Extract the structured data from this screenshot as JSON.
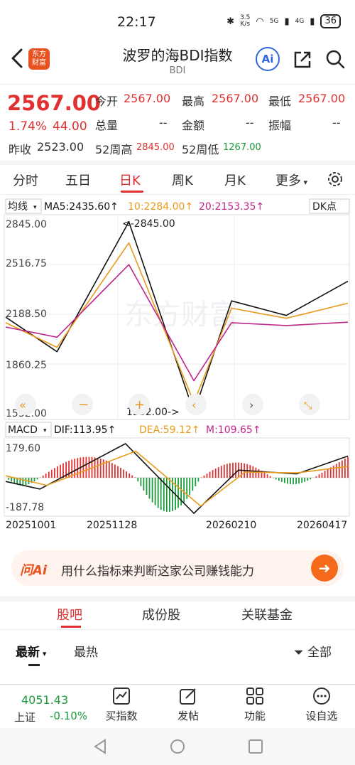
{
  "status": {
    "time": "22:17",
    "network_speed_top": "3.5",
    "network_speed_unit": "K/s",
    "signal_1": "5G",
    "signal_2": "4G",
    "battery": "36"
  },
  "header": {
    "logo_line1": "东方",
    "logo_line2": "财富",
    "title": "波罗的海BDI指数",
    "subtitle": "BDI",
    "ai_label": "Ai"
  },
  "quote": {
    "price": "2567.00",
    "change_pct": "1.74%",
    "change_abs": "44.00",
    "open_label": "今开",
    "open": "2567.00",
    "high_label": "最高",
    "high": "2567.00",
    "low_label": "最低",
    "low": "2567.00",
    "volume_label": "总量",
    "volume": "--",
    "amount_label": "金额",
    "amount": "--",
    "amplitude_label": "振幅",
    "amplitude": "--",
    "prev_close_label": "昨收",
    "prev_close": "2523.00",
    "week52_high_label": "52周高",
    "week52_high": "2845.00",
    "week52_low_label": "52周低",
    "week52_low": "1267.00"
  },
  "tabs": [
    {
      "label": "分时"
    },
    {
      "label": "五日"
    },
    {
      "label": "日K"
    },
    {
      "label": "周K"
    },
    {
      "label": "月K"
    },
    {
      "label": "更多"
    }
  ],
  "chart": {
    "ma_selector": "均线",
    "ma5_label": "MA5:2435.60↑",
    "ma10_label": "10:2284.00↑",
    "ma20_label": "20:2153.35↑",
    "dk_label": "DK点",
    "y_ticks": [
      "2845.00",
      "2516.75",
      "2188.50",
      "1860.25",
      "1532.00"
    ],
    "max_annotation": "<-2845.00",
    "min_annotation": "1532.00->",
    "watermark": "东方财富",
    "macd_selector": "MACD",
    "dif_label": "DIF:113.95↑",
    "dea_label": "DEA:59.12↑",
    "m_label": "M:109.65↑",
    "macd_top": "179.60",
    "macd_bottom": "-187.78",
    "dates": [
      "20251001",
      "20251128",
      "20260210",
      "20260417"
    ],
    "colors": {
      "ma5": "#111111",
      "ma10": "#e89a1a",
      "ma20": "#c0268a",
      "up": "#e03030",
      "down": "#1a9a3a"
    }
  },
  "chart_data": {
    "type": "line",
    "x": [
      "20251001",
      "20251128",
      "20260210",
      "20260417"
    ],
    "ylim": [
      1532.0,
      2845.0
    ],
    "series": [
      {
        "name": "MA5",
        "values": [
          2188,
          1950,
          2845,
          1532,
          2300,
          2200,
          2435.6
        ]
      },
      {
        "name": "10",
        "values": [
          2150,
          1980,
          2700,
          1600,
          2250,
          2180,
          2284.0
        ]
      },
      {
        "name": "20",
        "values": [
          2120,
          2050,
          2550,
          1750,
          2150,
          2130,
          2153.35
        ]
      }
    ],
    "macd": {
      "ylim": [
        -187.78,
        179.6
      ],
      "DIF": 113.95,
      "DEA": 59.12,
      "M": 109.65
    }
  },
  "wencai": {
    "logo": "问Ai",
    "prompt": "用什么指标来判断这家公司赚钱能力"
  },
  "sub_tabs": [
    {
      "label": "股吧"
    },
    {
      "label": "成份股"
    },
    {
      "label": "关联基金"
    }
  ],
  "filters": {
    "latest": "最新",
    "hottest": "最热",
    "all": "全部"
  },
  "footer": {
    "index_value": "4051.43",
    "index_name": "上证",
    "index_change": "-0.10%",
    "buy": "买指数",
    "post": "发帖",
    "features": "功能",
    "watchlist": "设自选"
  }
}
